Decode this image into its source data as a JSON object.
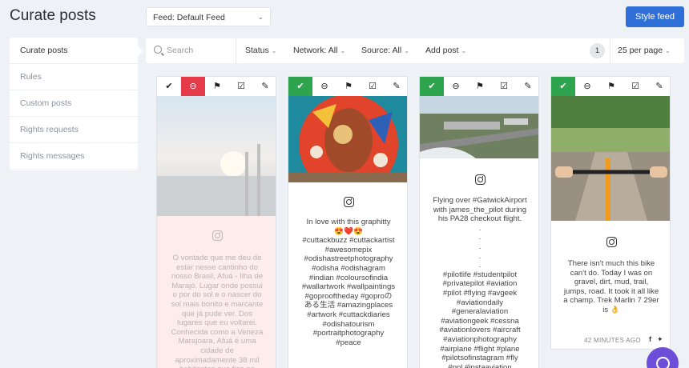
{
  "header": {
    "title": "Curate posts",
    "feed_select": "Feed: Default Feed",
    "style_button": "Style feed"
  },
  "sidebar": {
    "items": [
      {
        "label": "Curate posts"
      },
      {
        "label": "Rules"
      },
      {
        "label": "Custom posts"
      },
      {
        "label": "Rights requests"
      },
      {
        "label": "Rights messages"
      }
    ]
  },
  "filters": {
    "search_placeholder": "Search",
    "status": "Status",
    "network": "Network: All",
    "source": "Source: All",
    "add_post": "Add post",
    "page": "1",
    "per_page": "25 per page"
  },
  "posts": [
    {
      "status": "rejected",
      "caption": "O vontade que me deu de\nestar nesse cantinho do\nnosso Brasil, Afuá - Ilha de\nMarajó. Lugar onde possui\no por do sol e o nascer do\nsol mais bonito e marcante\nque já pude ver. Dos\nlugares que eu voltarei.\nConhecida como a Veneza\nMarajoara, Afuá é uma\ncidade de\naproximadamente 38 mil\nhabitantes que fica no"
    },
    {
      "status": "approved",
      "caption": "In love with this graphitty\n😍❤️😍\n#cuttackbuzz #cuttackartist\n#awesomepix\n#odishastreetphotography\n#odisha #odishagram\n#indian #coloursofindia\n#wallartwork #wallpaintings\n#goprooftheday #goproの\nある生活 #amazingplaces\n#artwork #cuttackdiaries\n#odishatourism\n#portraitphotography\n#peace"
    },
    {
      "status": "approved",
      "caption": "Flying over #GatwickAirport\nwith james_the_pilot during\nhis PA28 checkout flight.\n.\n.\n.\n.\n.\n#pilotlife #studentpilot\n#privatepilot #aviation\n#pilot #flying #avgeek\n#aviationdaily\n#generalaviation\n#aviationgeek #cessna\n#aviationlovers #aircraft\n#aviationphotography\n#airplane #flight #plane\n#pilotsofinstagram #fly\n#ppl #instaaviation"
    },
    {
      "status": "approved",
      "caption": "There isn't much this bike\ncan't do. Today I was on\ngravel, dirt, mud, trail,\njumps, road. It took it all like\na champ. Trek Marlin 7 29er\nis 👌",
      "time": "42 MINUTES AGO"
    }
  ]
}
